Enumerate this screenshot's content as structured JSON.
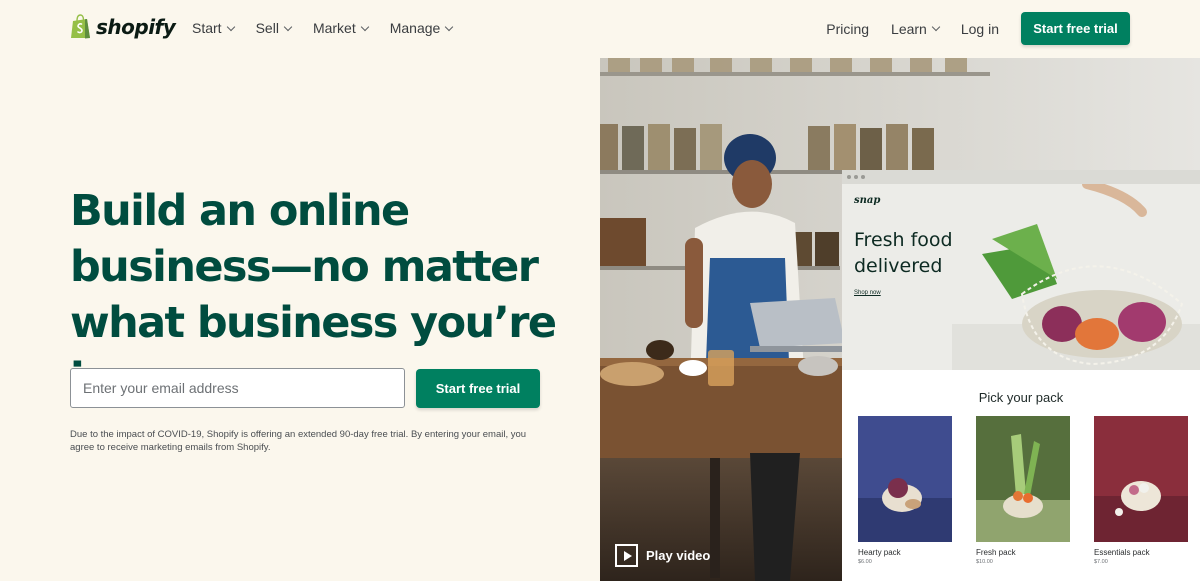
{
  "nav": {
    "logo_text": "shopify",
    "left_items": [
      "Start",
      "Sell",
      "Market",
      "Manage"
    ],
    "pricing": "Pricing",
    "learn": "Learn",
    "login": "Log in",
    "cta": "Start free trial"
  },
  "hero": {
    "headline": "Build an online business—no matter what business you’re in",
    "email_placeholder": "Enter your email address",
    "cta": "Start free trial",
    "disclaimer": "Due to the impact of COVID-19, Shopify is offering an extended 90-day free trial. By entering your email, you agree to receive marketing emails from Shopify."
  },
  "video": {
    "label": "Play video"
  },
  "mockup": {
    "brand": "snap",
    "headline": "Fresh food delivered",
    "link": "Shop now",
    "section_title": "Pick your pack",
    "packs": [
      {
        "name": "Hearty pack",
        "price": "$6.00"
      },
      {
        "name": "Fresh pack",
        "price": "$10.00"
      },
      {
        "name": "Essentials pack",
        "price": "$7.00"
      }
    ]
  },
  "colors": {
    "brand_green": "#008060",
    "headline_green": "#004c3f",
    "background": "#fbf7ed"
  }
}
